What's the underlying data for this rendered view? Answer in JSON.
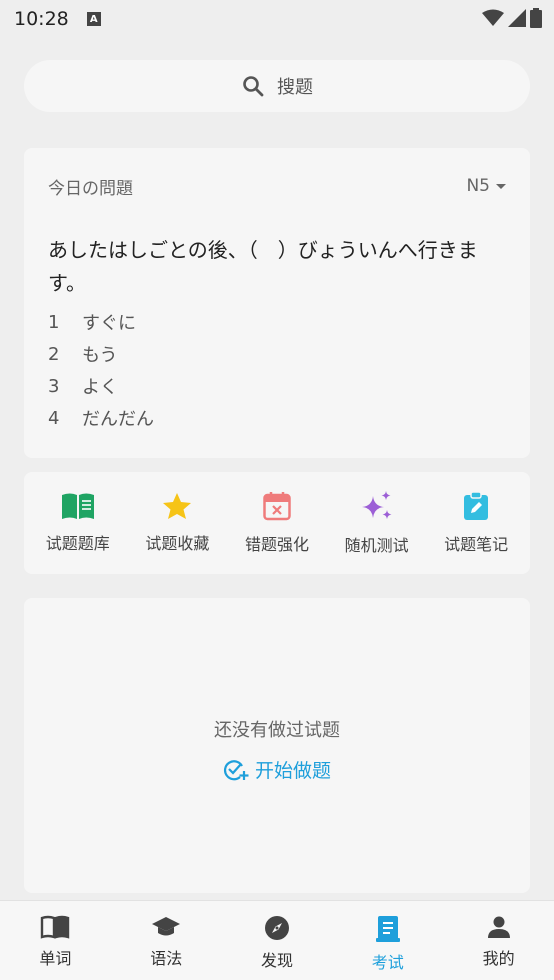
{
  "status": {
    "time": "10:28",
    "a_badge": "A"
  },
  "search": {
    "label": "搜题"
  },
  "question": {
    "title": "今日の問題",
    "level": "N5",
    "text": "あしたはしごとの後、（　）びょういんへ行きます。",
    "options": [
      {
        "num": "1",
        "text": "すぐに"
      },
      {
        "num": "2",
        "text": "もう"
      },
      {
        "num": "3",
        "text": "よく"
      },
      {
        "num": "4",
        "text": "だんだん"
      }
    ]
  },
  "tools": [
    {
      "label": "试题题库",
      "icon": "book-open-icon",
      "color": "#1fa463"
    },
    {
      "label": "试题收藏",
      "icon": "star-icon",
      "color": "#f6c417"
    },
    {
      "label": "错题强化",
      "icon": "calendar-x-icon",
      "color": "#ef7b7b"
    },
    {
      "label": "随机测试",
      "icon": "sparkles-icon",
      "color": "#9c5fd6"
    },
    {
      "label": "试题笔记",
      "icon": "clipboard-edit-icon",
      "color": "#33bde0"
    }
  ],
  "empty": {
    "text": "还没有做过试题",
    "start_label": "开始做题"
  },
  "nav": [
    {
      "label": "单词",
      "icon": "book-icon"
    },
    {
      "label": "语法",
      "icon": "graduation-cap-icon"
    },
    {
      "label": "发现",
      "icon": "compass-icon"
    },
    {
      "label": "考试",
      "icon": "exam-icon",
      "active": true
    },
    {
      "label": "我的",
      "icon": "person-icon"
    }
  ],
  "colors": {
    "accent": "#1e9fdb",
    "background": "#eeeeee",
    "card": "#f6f6f6"
  }
}
